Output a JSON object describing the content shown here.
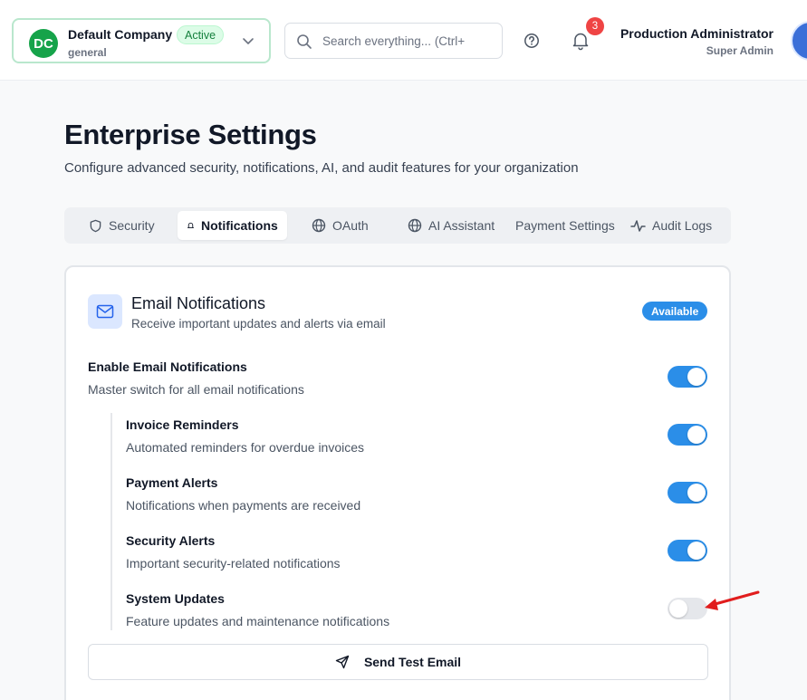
{
  "header": {
    "company": {
      "initials": "DC",
      "name": "Default Company",
      "status": "Active",
      "workspace": "general"
    },
    "search": {
      "placeholder": "Search everything... (Ctrl+"
    },
    "notifications_count": "3",
    "user": {
      "name": "Production Administrator",
      "role": "Super Admin"
    }
  },
  "page": {
    "title": "Enterprise Settings",
    "description": "Configure advanced security, notifications, AI, and audit features for your organization"
  },
  "tabs": [
    {
      "label": "Security",
      "icon": "shield-icon",
      "active": false
    },
    {
      "label": "Notifications",
      "icon": "bell-icon",
      "active": true
    },
    {
      "label": "OAuth",
      "icon": "globe-icon",
      "active": false
    },
    {
      "label": "AI Assistant",
      "icon": "globe-icon",
      "active": false
    },
    {
      "label": "Payment Settings",
      "icon": "",
      "active": false
    },
    {
      "label": "Audit Logs",
      "icon": "activity-icon",
      "active": false
    }
  ],
  "email_card": {
    "title": "Email Notifications",
    "subtitle": "Receive important updates and alerts via email",
    "badge": "Available",
    "master": {
      "label": "Enable Email Notifications",
      "desc": "Master switch for all email notifications",
      "enabled": true
    },
    "options": [
      {
        "label": "Invoice Reminders",
        "desc": "Automated reminders for overdue invoices",
        "enabled": true
      },
      {
        "label": "Payment Alerts",
        "desc": "Notifications when payments are received",
        "enabled": true
      },
      {
        "label": "Security Alerts",
        "desc": "Important security-related notifications",
        "enabled": true
      },
      {
        "label": "System Updates",
        "desc": "Feature updates and maintenance notifications",
        "enabled": false
      }
    ],
    "test_button": "Send Test Email"
  },
  "colors": {
    "accent": "#2b8ee8",
    "brand_green": "#16a34a",
    "badge_red": "#ef4444",
    "annotation_arrow": "#e11d1d"
  }
}
